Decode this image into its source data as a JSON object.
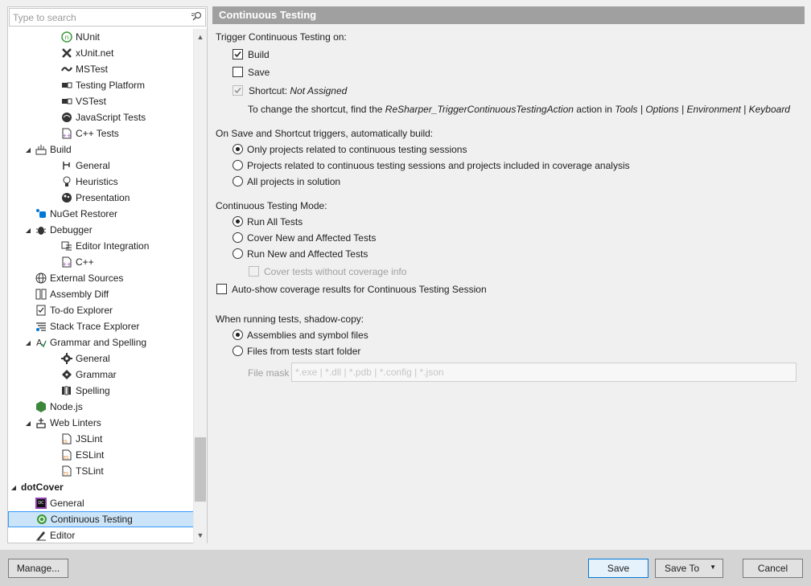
{
  "search": {
    "placeholder": "Type to search"
  },
  "tree": [
    {
      "label": "NUnit",
      "icon": "nunit-icon",
      "level": 3
    },
    {
      "label": "xUnit.net",
      "icon": "xunit-icon",
      "level": 3
    },
    {
      "label": "MSTest",
      "icon": "mstest-icon",
      "level": 3
    },
    {
      "label": "Testing Platform",
      "icon": "testing-platform-icon",
      "level": 3
    },
    {
      "label": "VSTest",
      "icon": "vstest-icon",
      "level": 3
    },
    {
      "label": "JavaScript Tests",
      "icon": "javascript-tests-icon",
      "level": 3
    },
    {
      "label": "C++ Tests",
      "icon": "cpp-tests-icon",
      "level": 3
    },
    {
      "label": "Build",
      "icon": "build-icon",
      "level": 2,
      "expanded": true
    },
    {
      "label": "General",
      "icon": "general-icon",
      "level": 3
    },
    {
      "label": "Heuristics",
      "icon": "lightbulb-icon",
      "level": 3
    },
    {
      "label": "Presentation",
      "icon": "presentation-icon",
      "level": 3
    },
    {
      "label": "NuGet Restorer",
      "icon": "nuget-icon",
      "level": 2
    },
    {
      "label": "Debugger",
      "icon": "bug-icon",
      "level": 2,
      "expanded": true
    },
    {
      "label": "Editor Integration",
      "icon": "editor-integration-icon",
      "level": 3
    },
    {
      "label": "C++",
      "icon": "cpp-icon",
      "level": 3
    },
    {
      "label": "External Sources",
      "icon": "globe-icon",
      "level": 2
    },
    {
      "label": "Assembly Diff",
      "icon": "diff-icon",
      "level": 2
    },
    {
      "label": "To-do Explorer",
      "icon": "todo-icon",
      "level": 2
    },
    {
      "label": "Stack Trace Explorer",
      "icon": "stack-trace-icon",
      "level": 2
    },
    {
      "label": "Grammar and Spelling",
      "icon": "grammar-icon",
      "level": 2,
      "expanded": true
    },
    {
      "label": "General",
      "icon": "gear-icon",
      "level": 3
    },
    {
      "label": "Grammar",
      "icon": "grammar-diamond-icon",
      "level": 3
    },
    {
      "label": "Spelling",
      "icon": "spelling-icon",
      "level": 3
    },
    {
      "label": "Node.js",
      "icon": "nodejs-icon",
      "level": 2
    },
    {
      "label": "Web Linters",
      "icon": "web-linters-icon",
      "level": 2,
      "expanded": true
    },
    {
      "label": "JSLint",
      "icon": "jslint-icon",
      "level": 3
    },
    {
      "label": "ESLint",
      "icon": "eslint-icon",
      "level": 3
    },
    {
      "label": "TSLint",
      "icon": "tslint-icon",
      "level": 3
    },
    {
      "label": "dotCover",
      "icon": "",
      "level": 1,
      "expanded": true,
      "bold": true
    },
    {
      "label": "General",
      "icon": "dotcover-icon",
      "level": 2
    },
    {
      "label": "Continuous Testing",
      "icon": "continuous-testing-icon",
      "level": 2,
      "selected": true
    },
    {
      "label": "Editor",
      "icon": "editor-icon",
      "level": 2
    }
  ],
  "header": {
    "title": "Continuous Testing"
  },
  "trigger": {
    "heading": "Trigger Continuous Testing on:",
    "build": "Build",
    "save": "Save",
    "shortcut_label": "Shortcut:",
    "shortcut_value": "Not Assigned",
    "hint_prefix": "To change the shortcut, find the ",
    "hint_action": "ReSharper_TriggerContinuousTestingAction",
    "hint_mid": " action in ",
    "hint_path": "Tools | Options | Environment | Keyboard"
  },
  "autobuild": {
    "heading": "On Save and Shortcut triggers, automatically build:",
    "options": [
      "Only projects related to continuous testing sessions",
      "Projects related to continuous testing sessions and projects included in coverage analysis",
      "All projects in solution"
    ]
  },
  "mode": {
    "heading": "Continuous Testing Mode:",
    "options": [
      "Run All Tests",
      "Cover New and Affected Tests",
      "Run New and Affected Tests"
    ],
    "cover_without": "Cover tests without coverage info"
  },
  "autoshow": "Auto-show coverage results for Continuous Testing Session",
  "shadow": {
    "heading": "When running tests, shadow-copy:",
    "options": [
      "Assemblies and symbol files",
      "Files from tests start folder"
    ],
    "file_mask_label": "File mask",
    "file_mask_placeholder": "*.exe | *.dll | *.pdb | *.config | *.json"
  },
  "buttons": {
    "manage": "Manage...",
    "save": "Save",
    "save_to": "Save To",
    "cancel": "Cancel"
  },
  "colors": {
    "selection": "#cce4f7",
    "selection_border": "#3399ff",
    "header_bg": "#a0a0a0",
    "accent": "#0078d7"
  }
}
